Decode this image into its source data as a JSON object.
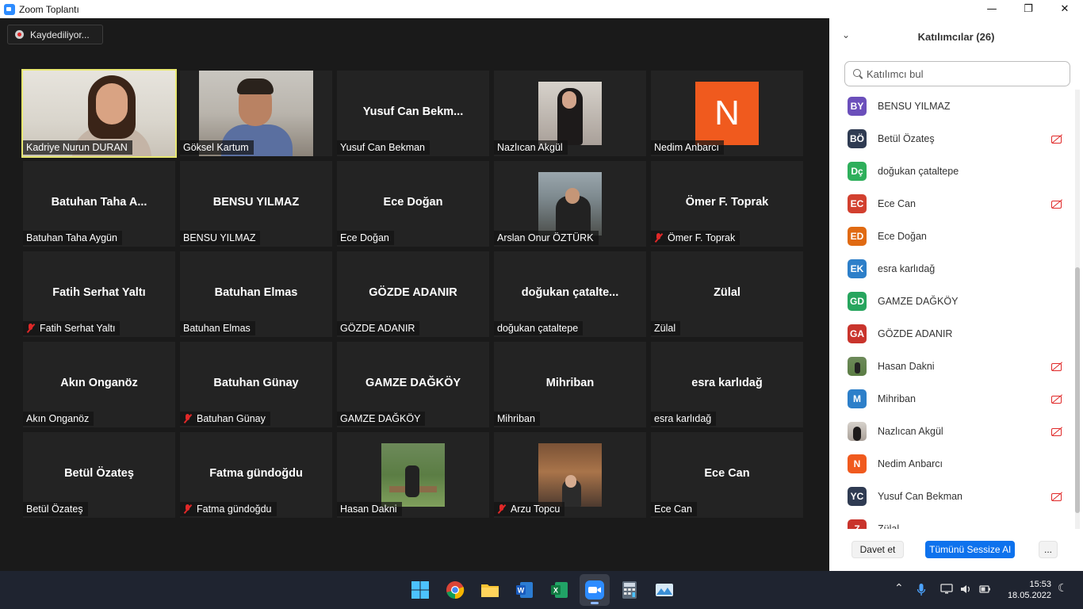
{
  "window": {
    "title": "Zoom Toplantı",
    "controls": {
      "minimize": "—",
      "maximize": "❐",
      "close": "✕"
    }
  },
  "meeting": {
    "recording_label": "Kaydediliyor...",
    "active_speaker": "Kadriye Nurun DURAN",
    "tiles": [
      {
        "label": "Kadriye Nurun DURAN",
        "center_name": "",
        "video": "kadriye",
        "muted": false
      },
      {
        "label": "Göksel Kartum",
        "center_name": "",
        "video": "goksel",
        "muted": false
      },
      {
        "label": "Yusuf Can Bekman",
        "center_name": "Yusuf Can Bekm...",
        "video": "",
        "muted": false
      },
      {
        "label": "Nazlıcan Akgül",
        "center_name": "",
        "video": "nazlican",
        "muted": false
      },
      {
        "label": "Nedim Anbarcı",
        "center_name": "",
        "video": "nedim",
        "muted": false
      },
      {
        "label": "Batuhan Taha Aygün",
        "center_name": "Batuhan Taha A...",
        "video": "",
        "muted": false
      },
      {
        "label": "BENSU YILMAZ",
        "center_name": "BENSU YILMAZ",
        "video": "",
        "muted": false
      },
      {
        "label": "Ece Doğan",
        "center_name": "Ece Doğan",
        "video": "",
        "muted": false
      },
      {
        "label": "Arslan Onur ÖZTÜRK",
        "center_name": "",
        "video": "arslan",
        "muted": false
      },
      {
        "label": "Ömer F. Toprak",
        "center_name": "Ömer F. Toprak",
        "video": "",
        "muted": true
      },
      {
        "label": "Fatih Serhat Yaltı",
        "center_name": "Fatih Serhat Yaltı",
        "video": "",
        "muted": true
      },
      {
        "label": "Batuhan Elmas",
        "center_name": "Batuhan Elmas",
        "video": "",
        "muted": false
      },
      {
        "label": "GÖZDE ADANIR",
        "center_name": "GÖZDE ADANIR",
        "video": "",
        "muted": false
      },
      {
        "label": "doğukan çataltepe",
        "center_name": "doğukan  çatalte...",
        "video": "",
        "muted": false
      },
      {
        "label": "Zülal",
        "center_name": "Zülal",
        "video": "",
        "muted": false
      },
      {
        "label": "Akın Onganöz",
        "center_name": "Akın Onganöz",
        "video": "",
        "muted": false
      },
      {
        "label": "Batuhan Günay",
        "center_name": "Batuhan Günay",
        "video": "",
        "muted": true
      },
      {
        "label": "GAMZE DAĞKÖY",
        "center_name": "GAMZE DAĞKÖY",
        "video": "",
        "muted": false
      },
      {
        "label": "Mihriban",
        "center_name": "Mihriban",
        "video": "",
        "muted": false
      },
      {
        "label": "esra karlıdağ",
        "center_name": "esra karlıdağ",
        "video": "",
        "muted": false
      },
      {
        "label": "Betül Özateş",
        "center_name": "Betül Özateş",
        "video": "",
        "muted": false
      },
      {
        "label": "Fatma gündoğdu",
        "center_name": "Fatma gündoğdu",
        "video": "",
        "muted": true
      },
      {
        "label": "Hasan Dakni",
        "center_name": "",
        "video": "hasan",
        "muted": false
      },
      {
        "label": "Arzu Topcu",
        "center_name": "",
        "video": "arzu",
        "muted": true
      },
      {
        "label": "Ece Can",
        "center_name": "Ece Can",
        "video": "",
        "muted": false
      }
    ],
    "nedim_initial": "N"
  },
  "participants_panel": {
    "title": "Katılımcılar (26)",
    "collapse_glyph": "⌄",
    "search_placeholder": "Katılımcı bul",
    "participants": [
      {
        "initials": "BY",
        "name": "BENSU YILMAZ",
        "color": "#6b4fbb",
        "photo": "",
        "camera_off": false
      },
      {
        "initials": "BÖ",
        "name": "Betül Özateş",
        "color": "#2f3b52",
        "photo": "",
        "camera_off": true
      },
      {
        "initials": "Dç",
        "name": "doğukan çataltepe",
        "color": "#2eaf5b",
        "photo": "",
        "camera_off": false
      },
      {
        "initials": "EC",
        "name": "Ece Can",
        "color": "#d2402f",
        "photo": "",
        "camera_off": true
      },
      {
        "initials": "ED",
        "name": "Ece Doğan",
        "color": "#e06a12",
        "photo": "",
        "camera_off": false
      },
      {
        "initials": "EK",
        "name": "esra karlıdağ",
        "color": "#2d7fc9",
        "photo": "",
        "camera_off": false
      },
      {
        "initials": "GD",
        "name": "GAMZE DAĞKÖY",
        "color": "#27a55e",
        "photo": "",
        "camera_off": false
      },
      {
        "initials": "GA",
        "name": "GÖZDE ADANIR",
        "color": "#c9342c",
        "photo": "",
        "camera_off": false
      },
      {
        "initials": "",
        "name": "Hasan Dakni",
        "color": "#5b7d44",
        "photo": "hasan",
        "camera_off": true
      },
      {
        "initials": "M",
        "name": "Mihriban",
        "color": "#2d7fc9",
        "photo": "",
        "camera_off": true
      },
      {
        "initials": "",
        "name": "Nazlıcan Akgül",
        "color": "#b9aea6",
        "photo": "nazlican",
        "camera_off": true
      },
      {
        "initials": "N",
        "name": "Nedim Anbarcı",
        "color": "#f05a1e",
        "photo": "",
        "camera_off": false
      },
      {
        "initials": "YC",
        "name": "Yusuf Can Bekman",
        "color": "#2f3b52",
        "photo": "",
        "camera_off": true
      },
      {
        "initials": "Z",
        "name": "Zülal",
        "color": "#c9342c",
        "photo": "",
        "camera_off": false
      }
    ],
    "invite_label": "Davet et",
    "mute_all_label": "Tümünü Sessize Al",
    "more_label": "..."
  },
  "taskbar": {
    "apps": [
      "windows-start-icon",
      "chrome-icon",
      "file-explorer-icon",
      "word-icon",
      "excel-icon",
      "zoom-icon",
      "calculator-icon",
      "photos-icon"
    ],
    "tray": {
      "chevron": "⌃",
      "mic": "🎙",
      "display": "▭",
      "volume": "🔊",
      "battery": "▯",
      "night": "☾"
    },
    "time": "15:53",
    "date": "18.05.2022"
  }
}
